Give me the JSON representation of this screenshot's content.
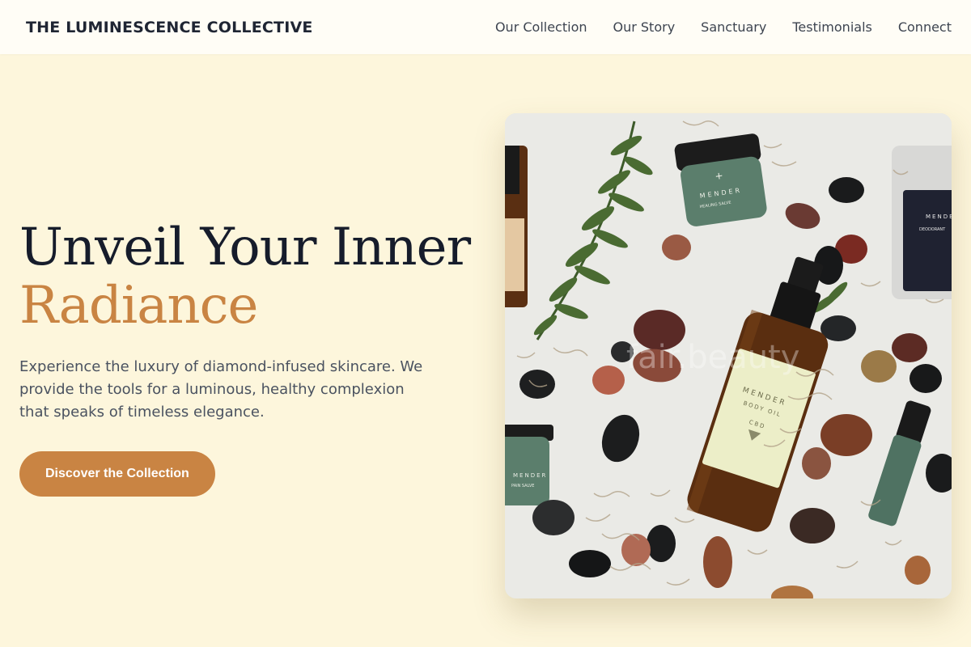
{
  "nav": {
    "brand": "THE LUMINESCENCE COLLECTIVE",
    "links": [
      "Our Collection",
      "Our Story",
      "Sanctuary",
      "Testimonials",
      "Connect"
    ]
  },
  "hero": {
    "headline_line1": "Unveil Your Inner",
    "headline_line2": "Radiance",
    "description": "Experience the luxury of diamond-infused skincare. We provide the tools for a luminous, healthy complexion that speaks of timeless elegance.",
    "cta_label": "Discover the Collection",
    "image": {
      "watermark": "fair.beauty",
      "jar_label_top": "MENDER",
      "jar_label_top_sub": "HEALING SALVE",
      "bottle_label": "MENDER",
      "bottle_label_sub": "BODY OIL",
      "bottle_label_cbd": "CBD",
      "jar_label_left": "MENDER",
      "jar_label_left_sub": "PAIN SALVE",
      "stick_label": "MENDER",
      "stick_label_sub": "DEODORANT"
    }
  },
  "colors": {
    "background": "#fdf6dc",
    "accent": "#c98443",
    "heading": "#161c2b",
    "body_text": "#4a5260"
  }
}
